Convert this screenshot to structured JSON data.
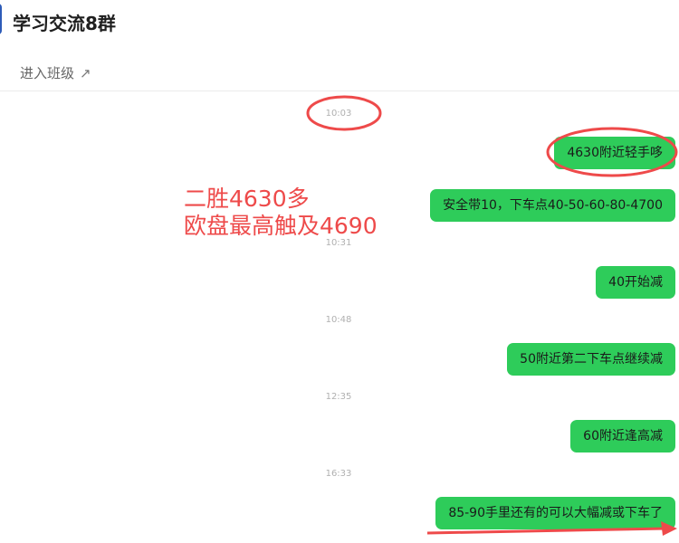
{
  "header": {
    "title": "学习交流8群",
    "enter_class_label": "进入班级",
    "enter_class_arrow": "↗"
  },
  "messages": [
    {
      "time": "10:03",
      "text": "4630附近轻手哆"
    },
    {
      "text": "安全带10，下车点40-50-60-80-4700"
    },
    {
      "time": "10:31",
      "text": "40开始减"
    },
    {
      "time": "10:48",
      "text": "50附近第二下车点继续减"
    },
    {
      "time": "12:35",
      "text": "60附近逢高减"
    },
    {
      "time": "16:33",
      "text": "85-90手里还有的可以大幅减或下车了"
    }
  ],
  "annotation": {
    "line1": "二胜4630多",
    "line2": "欧盘最高触及4690",
    "color": "#ee4a4a"
  },
  "colors": {
    "bubble": "#2ecc5a",
    "markup": "#ee4a4a"
  }
}
